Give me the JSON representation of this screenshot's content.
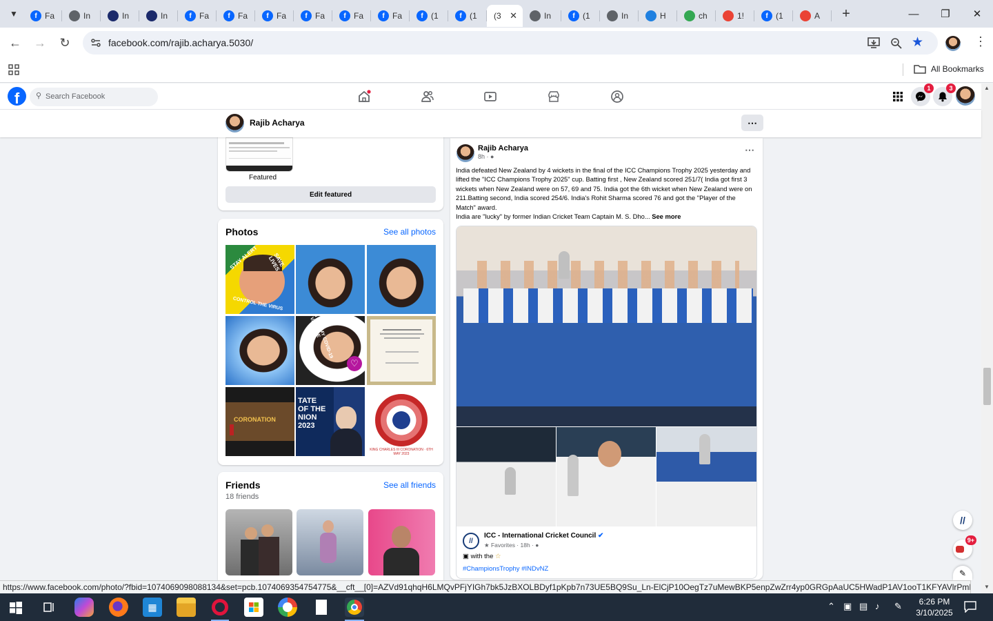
{
  "browser": {
    "tabs": [
      {
        "label": "Fa",
        "icon": "facebook-icon",
        "color": "#0866ff"
      },
      {
        "label": "In",
        "icon": "record-icon",
        "color": "#5f6368"
      },
      {
        "label": "In",
        "icon": "icc-icon",
        "color": "#1b2a6b"
      },
      {
        "label": "In",
        "icon": "icc-icon",
        "color": "#1b2a6b"
      },
      {
        "label": "Fa",
        "icon": "facebook-icon",
        "color": "#0866ff"
      },
      {
        "label": "Fa",
        "icon": "facebook-icon",
        "color": "#0866ff"
      },
      {
        "label": "Fa",
        "icon": "facebook-icon",
        "color": "#0866ff"
      },
      {
        "label": "Fa",
        "icon": "facebook-icon",
        "color": "#0866ff"
      },
      {
        "label": "Fa",
        "icon": "facebook-icon",
        "color": "#0866ff"
      },
      {
        "label": "Fa",
        "icon": "facebook-icon",
        "color": "#0866ff"
      },
      {
        "label": "(1",
        "icon": "facebook-icon",
        "color": "#0866ff"
      },
      {
        "label": "(1",
        "icon": "facebook-icon",
        "color": "#0866ff"
      },
      {
        "label": "(3",
        "icon": "",
        "color": "#ffffff",
        "active": true
      },
      {
        "label": "In",
        "icon": "globe-icon",
        "color": "#5f6368"
      },
      {
        "label": "(1",
        "icon": "facebook-icon",
        "color": "#0866ff"
      },
      {
        "label": "In",
        "icon": "globe-icon",
        "color": "#5f6368"
      },
      {
        "label": "H",
        "icon": "hotstar-icon",
        "color": "#1f80e0"
      },
      {
        "label": "ch",
        "icon": "drive-icon",
        "color": "#34a853"
      },
      {
        "label": "1!",
        "icon": "gmail-icon",
        "color": "#ea4335"
      },
      {
        "label": "(1",
        "icon": "facebook-icon",
        "color": "#0866ff"
      },
      {
        "label": "A",
        "icon": "gmail-icon",
        "color": "#ea4335"
      }
    ],
    "url": "facebook.com/rajib.acharya.5030/",
    "bookmarks_label": "All Bookmarks",
    "status_url": "https://www.facebook.com/photo/?fbid=1074069098088134&set=pcb.1074069354754775&__cft__[0]=AZVd91qhqH6LMQvPFjYIGh7bk5JzBXOLBDyf1pKpb7n73UE5BQ9Su_Ln-ElCjP10OegTz7uMewBKP5enpZwZrr4yp0GRGpAaUC5HWadP1AV1ooT1KFYAVlrPmBoTsE..."
  },
  "facebook": {
    "search_placeholder": "Search Facebook",
    "messenger_badge": "1",
    "notifications_badge": "3",
    "profile_name": "Rajib Acharya",
    "featured_label": "Featured",
    "edit_featured": "Edit featured",
    "photos": {
      "title": "Photos",
      "see_all": "See all photos"
    },
    "friends": {
      "title": "Friends",
      "count": "18 friends",
      "see_all": "See all friends"
    },
    "post": {
      "author": "Rajib Acharya",
      "time": "8h",
      "text1": "India defeated New Zealand by 4 wickets in the final of the ICC Champions Trophy 2025 yesterday and lifted the \"ICC Champions Trophy 2025\" cup. Batting first , New Zealand scored 251/7( India got first 3 wickets when New Zealand were on 57, 69 and 75. India got the 6th wicket when New Zealand were on 211.Batting second, India scored 254/6. India's Rohit Sharma scored 76 and got the \"Player of the Match\" award.",
      "text2": "India are \"lucky\" by  former Indian Cricket Team Captain M. S. Dho...",
      "see_more": "See more",
      "shared_author": "ICC - International Cricket Council",
      "shared_meta": "Favorites · 18h ·",
      "shared_text": "with the",
      "hashtags": "#ChampionsTrophy #INDvNZ"
    },
    "photo_texts": {
      "stay_alert": "STAY ALERT",
      "save_lives": "SAVE LIVES",
      "control": "CONTROL THE VIRUS",
      "vaccine": "I GOT MY COVID-19 VACCINE",
      "coronation": "CORONATION",
      "state": "TATE OF THE NION 2023",
      "king": "KING CHARLES III CORONATION · 6TH MAY 2023"
    },
    "news_badge": "9+"
  },
  "taskbar": {
    "time": "6:26 PM",
    "date": "3/10/2025"
  }
}
